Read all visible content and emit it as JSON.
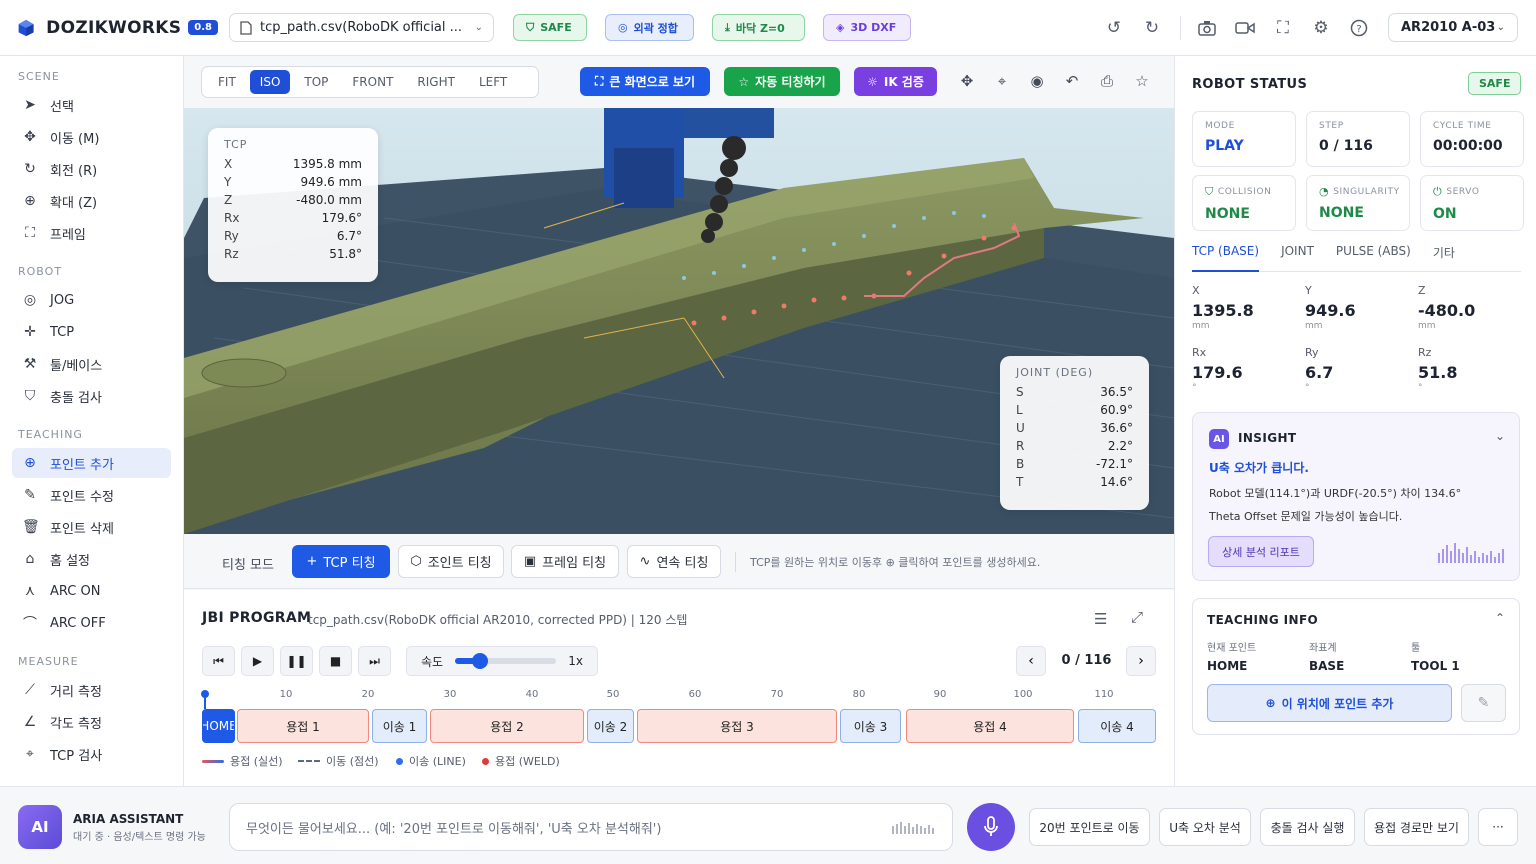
{
  "header": {
    "app_name": "DOZIKWORKS",
    "version": "0.8",
    "file": "tcp_path.csv(RoboDK official ...",
    "chips": [
      {
        "label": "SAFE",
        "icon": "shield-icon",
        "bg": "#e7f7ec",
        "fg": "#1f8a47",
        "border": "#8ed6a5"
      },
      {
        "label": "외곽 정합",
        "icon": "target-icon",
        "bg": "#e8eefb",
        "fg": "#1e4fd6",
        "border": "#a8bff0"
      },
      {
        "label": "바닥 Z=0",
        "icon": "download-icon",
        "bg": "#e7f7ec",
        "fg": "#1f8a47",
        "border": "#8ed6a5"
      },
      {
        "label": "3D DXF",
        "icon": "layers-icon",
        "bg": "#f1ecfc",
        "fg": "#6b3fd6",
        "border": "#c8b6f0"
      }
    ],
    "robot": "AR2010 A-03"
  },
  "sidebar": {
    "sections": [
      {
        "title": "SCENE",
        "items": [
          {
            "label": "선택",
            "icon": "cursor-icon"
          },
          {
            "label": "이동 (M)",
            "icon": "move-icon"
          },
          {
            "label": "회전 (R)",
            "icon": "rotate-icon"
          },
          {
            "label": "확대 (Z)",
            "icon": "zoom-icon"
          },
          {
            "label": "프레임",
            "icon": "frame-icon"
          }
        ]
      },
      {
        "title": "ROBOT",
        "items": [
          {
            "label": "JOG",
            "icon": "jog-icon"
          },
          {
            "label": "TCP",
            "icon": "tcp-icon"
          },
          {
            "label": "툴/베이스",
            "icon": "wrench-icon"
          },
          {
            "label": "충돌 검사",
            "icon": "shield-check-icon"
          }
        ]
      },
      {
        "title": "TEACHING",
        "items": [
          {
            "label": "포인트 추가",
            "icon": "add-circle-icon",
            "active": true
          },
          {
            "label": "포인트 수정",
            "icon": "edit-icon"
          },
          {
            "label": "포인트 삭제",
            "icon": "trash-icon"
          },
          {
            "label": "홈 설정",
            "icon": "home-icon"
          },
          {
            "label": "ARC ON",
            "icon": "arc-on-icon"
          },
          {
            "label": "ARC OFF",
            "icon": "arc-off-icon"
          }
        ]
      },
      {
        "title": "MEASURE",
        "items": [
          {
            "label": "거리 측정",
            "icon": "ruler-icon"
          },
          {
            "label": "각도 측정",
            "icon": "angle-icon"
          },
          {
            "label": "TCP 검사",
            "icon": "crosshair-icon"
          }
        ]
      }
    ]
  },
  "viewtoolbar": {
    "views": [
      "FIT",
      "ISO",
      "TOP",
      "FRONT",
      "RIGHT",
      "LEFT"
    ],
    "active_view": "ISO",
    "fullscreen_label": "큰 화면으로 보기",
    "auto_teach_label": "자동 티칭하기",
    "ik_label": "IK 검증"
  },
  "tcp_overlay": {
    "title": "TCP",
    "rows": [
      {
        "k": "X",
        "v": "1395.8 mm"
      },
      {
        "k": "Y",
        "v": "949.6 mm"
      },
      {
        "k": "Z",
        "v": "-480.0 mm"
      },
      {
        "k": "Rx",
        "v": "179.6°"
      },
      {
        "k": "Ry",
        "v": "6.7°"
      },
      {
        "k": "Rz",
        "v": "51.8°"
      }
    ]
  },
  "joint_overlay": {
    "title": "JOINT (DEG)",
    "rows": [
      {
        "k": "S",
        "v": "36.5°"
      },
      {
        "k": "L",
        "v": "60.9°"
      },
      {
        "k": "U",
        "v": "36.6°"
      },
      {
        "k": "R",
        "v": "2.2°"
      },
      {
        "k": "B",
        "v": "-72.1°"
      },
      {
        "k": "T",
        "v": "14.6°"
      }
    ]
  },
  "teachbar": {
    "mode_label": "티칭 모드",
    "buttons": [
      "TCP 티칭",
      "조인트 티칭",
      "프레임 티칭",
      "연속 티칭"
    ],
    "hint": "TCP를 원하는 위치로 이동후 ⊕ 클릭하여 포인트를 생성하세요."
  },
  "program": {
    "title": "JBI PROGRAM",
    "subtitle": "tcp_path.csv(RoboDK official AR2010, corrected PPD) | 120 스텝",
    "speed_label": "속도",
    "speed_value": "1x",
    "speed_level": 0.25,
    "step": "0 / 116",
    "ticks": [
      "10",
      "20",
      "30",
      "40",
      "50",
      "60",
      "70",
      "80",
      "90",
      "100",
      "110"
    ],
    "segments": [
      {
        "label": "HOME",
        "type": "home"
      },
      {
        "label": "용접 1",
        "type": "weld"
      },
      {
        "label": "이송 1",
        "type": "move"
      },
      {
        "label": "용접 2",
        "type": "weld"
      },
      {
        "label": "이송 2",
        "type": "move"
      },
      {
        "label": "용접 3",
        "type": "weld"
      },
      {
        "label": "이송 3",
        "type": "move"
      },
      {
        "label": "용접 4",
        "type": "weld"
      },
      {
        "label": "이송 4",
        "type": "move"
      }
    ],
    "legend": [
      "용접 (실선)",
      "이동 (점선)",
      "이송 (LINE)",
      "용접 (WELD)"
    ]
  },
  "status": {
    "title": "ROBOT STATUS",
    "badge": "SAFE",
    "cards": [
      {
        "label": "MODE",
        "value": "PLAY",
        "color": "#1e4fd6"
      },
      {
        "label": "STEP",
        "value": "0 / 116",
        "color": "#1e2330"
      },
      {
        "label": "CYCLE TIME",
        "value": "00:00:00",
        "color": "#1e2330"
      },
      {
        "label": "COLLISION",
        "value": "NONE",
        "color": "#1f8a47"
      },
      {
        "label": "SINGULARITY",
        "value": "NONE",
        "color": "#1f8a47"
      },
      {
        "label": "SERVO",
        "value": "ON",
        "color": "#1f8a47"
      }
    ],
    "tabs": [
      "TCP (BASE)",
      "JOINT",
      "PULSE (ABS)",
      "기타"
    ],
    "coords": [
      {
        "label": "X",
        "value": "1395.8",
        "unit": "mm"
      },
      {
        "label": "Y",
        "value": "949.6",
        "unit": "mm"
      },
      {
        "label": "Z",
        "value": "-480.0",
        "unit": "mm"
      },
      {
        "label": "Rx",
        "value": "179.6",
        "unit": "°"
      },
      {
        "label": "Ry",
        "value": "6.7",
        "unit": "°"
      },
      {
        "label": "Rz",
        "value": "51.8",
        "unit": "°"
      }
    ]
  },
  "insight": {
    "badge": "AI",
    "title": "INSIGHT",
    "headline": "U축 오차가 큽니다.",
    "line1": "Robot 모델(114.1°)과 URDF(-20.5°) 차이 134.6°",
    "line2": "Theta Offset 문제일 가능성이 높습니다.",
    "button": "상세 분석 리포트"
  },
  "teaching_info": {
    "title": "TEACHING INFO",
    "fields": [
      {
        "label": "현재 포인트",
        "value": "HOME"
      },
      {
        "label": "좌표계",
        "value": "BASE"
      },
      {
        "label": "툴",
        "value": "TOOL 1"
      }
    ],
    "add_button": "이 위치에 포인트 추가"
  },
  "assistant": {
    "avatar": "AI",
    "name": "ARIA ASSISTANT",
    "status": "대기 중 · 음성/텍스트 명령 가능",
    "placeholder": "무엇이든 물어보세요... (예: '20번 포인트로 이동해줘', 'U축 오차 분석해줘')",
    "quick": [
      "20번 포인트로 이동",
      "U축 오차 분석",
      "충돌 검사 실행",
      "용접 경로만 보기",
      "···"
    ]
  }
}
